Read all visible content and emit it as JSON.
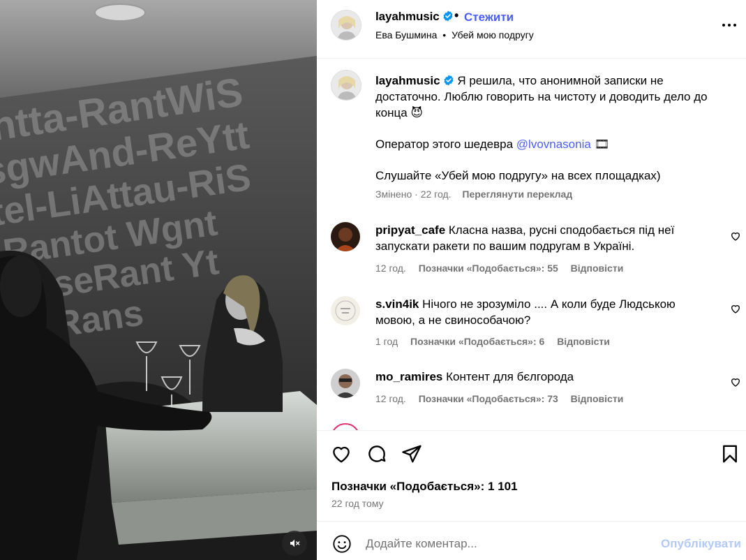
{
  "post": {
    "username": "layahmusic",
    "follow_label": "Стежити",
    "dot": "•",
    "sub_artist": "Ева Бушмина",
    "sub_sep": "•",
    "sub_track": "Убей мою подругу"
  },
  "media": {
    "mute_icon": "speaker-muted-icon"
  },
  "caption": {
    "username": "layahmusic",
    "line1": "Я решила, что анонимной записки не достаточно. Люблю говорить на чистоту и доводить дело до конца",
    "emoji1": "😈",
    "line2_prefix": "Оператор этого шедевра",
    "mention": "@lvovnasonia",
    "emoji2": "🎞",
    "line3": "Слушайте «Убей мою подругу» на всех площадках)",
    "edited": "Змінено",
    "meta_sep": "·",
    "time": "22 год.",
    "translate": "Переглянути переклад"
  },
  "comments": [
    {
      "username": "pripyat_cafe",
      "text": "Класна назва, русні сподобається під неї запускати ракети по вашим подругам в Україні.",
      "time": "12 год.",
      "likes": "Позначки «Подобається»: 55",
      "reply": "Відповісти"
    },
    {
      "username": "s.vin4ik",
      "text": "Нічого не зрозуміло .... А коли буде Людською мовою, а не свинособачою?",
      "time": "1 год",
      "likes": "Позначки «Подобається»: 6",
      "reply": "Відповісти"
    },
    {
      "username": "mo_ramires",
      "text": "Контент для бєлгорода",
      "time": "12 год.",
      "likes": "Позначки «Подобається»: 73",
      "reply": "Відповісти"
    }
  ],
  "actions": {
    "likes": "Позначки «Подобається»: 1 101",
    "time_ago": "22 год тому"
  },
  "composer": {
    "placeholder": "Додайте коментар...",
    "publish": "Опублікувати"
  },
  "colors": {
    "link_blue": "#4a5df9",
    "publish_disabled": "#b3c8fb",
    "secondary_text": "#737373",
    "border": "#efefef"
  }
}
